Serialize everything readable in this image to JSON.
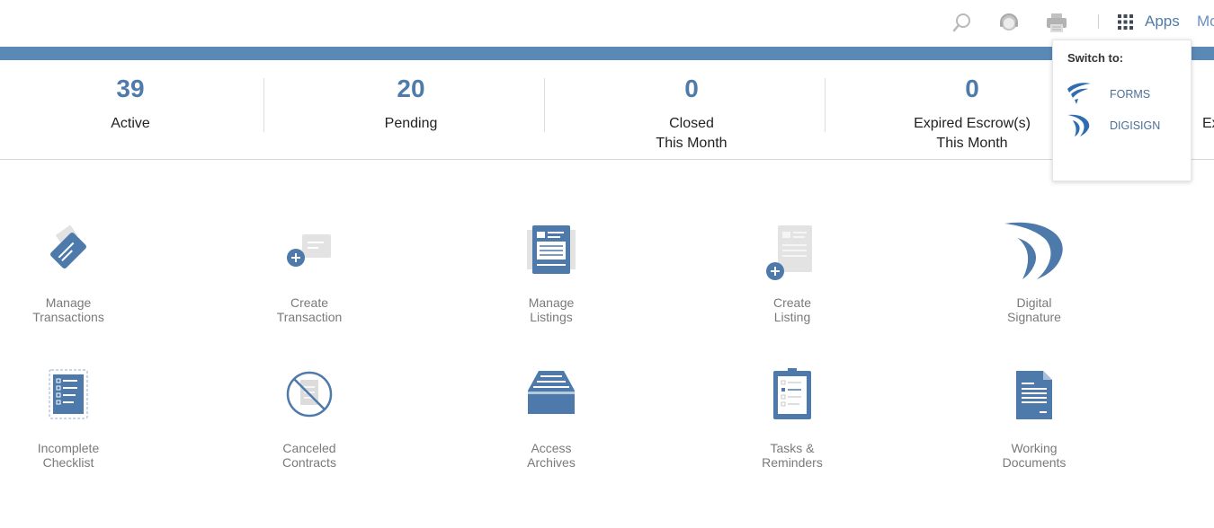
{
  "header": {
    "search_icon": "search-icon",
    "support_icon": "support-agent-icon",
    "print_icon": "printer-icon",
    "apps_label": "Apps",
    "more_label": "Mo"
  },
  "colors": {
    "accent": "#5b89b7",
    "stat_number": "#4f7bab",
    "icon_blue": "#4d7aaa",
    "icon_light": "#dcdcdc"
  },
  "stats": [
    {
      "number": "39",
      "line1": "Active",
      "line2": ""
    },
    {
      "number": "20",
      "line1": "Pending",
      "line2": ""
    },
    {
      "number": "0",
      "line1": "Closed",
      "line2": "This Month"
    },
    {
      "number": "0",
      "line1": "Expired Escrow(s)",
      "line2": "This Month"
    },
    {
      "number": "",
      "line1": "Ex",
      "line2": ""
    }
  ],
  "dropdown": {
    "title": "Switch to:",
    "items": [
      {
        "label": "FORMS",
        "icon": "forms-logo-icon"
      },
      {
        "label": "DIGISIGN",
        "icon": "digisign-logo-icon"
      }
    ]
  },
  "tiles": [
    {
      "line1": "Manage",
      "line2": "Transactions",
      "icon": "manage-transactions-icon"
    },
    {
      "line1": "Create",
      "line2": "Transaction",
      "icon": "create-transaction-icon"
    },
    {
      "line1": "Manage",
      "line2": "Listings",
      "icon": "manage-listings-icon"
    },
    {
      "line1": "Create",
      "line2": "Listing",
      "icon": "create-listing-icon"
    },
    {
      "line1": "Digital",
      "line2": "Signature",
      "icon": "digital-signature-icon"
    },
    {
      "line1": "Incomplete",
      "line2": "Checklist",
      "icon": "incomplete-checklist-icon"
    },
    {
      "line1": "Canceled",
      "line2": "Contracts",
      "icon": "canceled-contracts-icon"
    },
    {
      "line1": "Access",
      "line2": "Archives",
      "icon": "access-archives-icon"
    },
    {
      "line1": "Tasks &",
      "line2": "Reminders",
      "icon": "tasks-reminders-icon"
    },
    {
      "line1": "Working",
      "line2": "Documents",
      "icon": "working-documents-icon"
    }
  ]
}
